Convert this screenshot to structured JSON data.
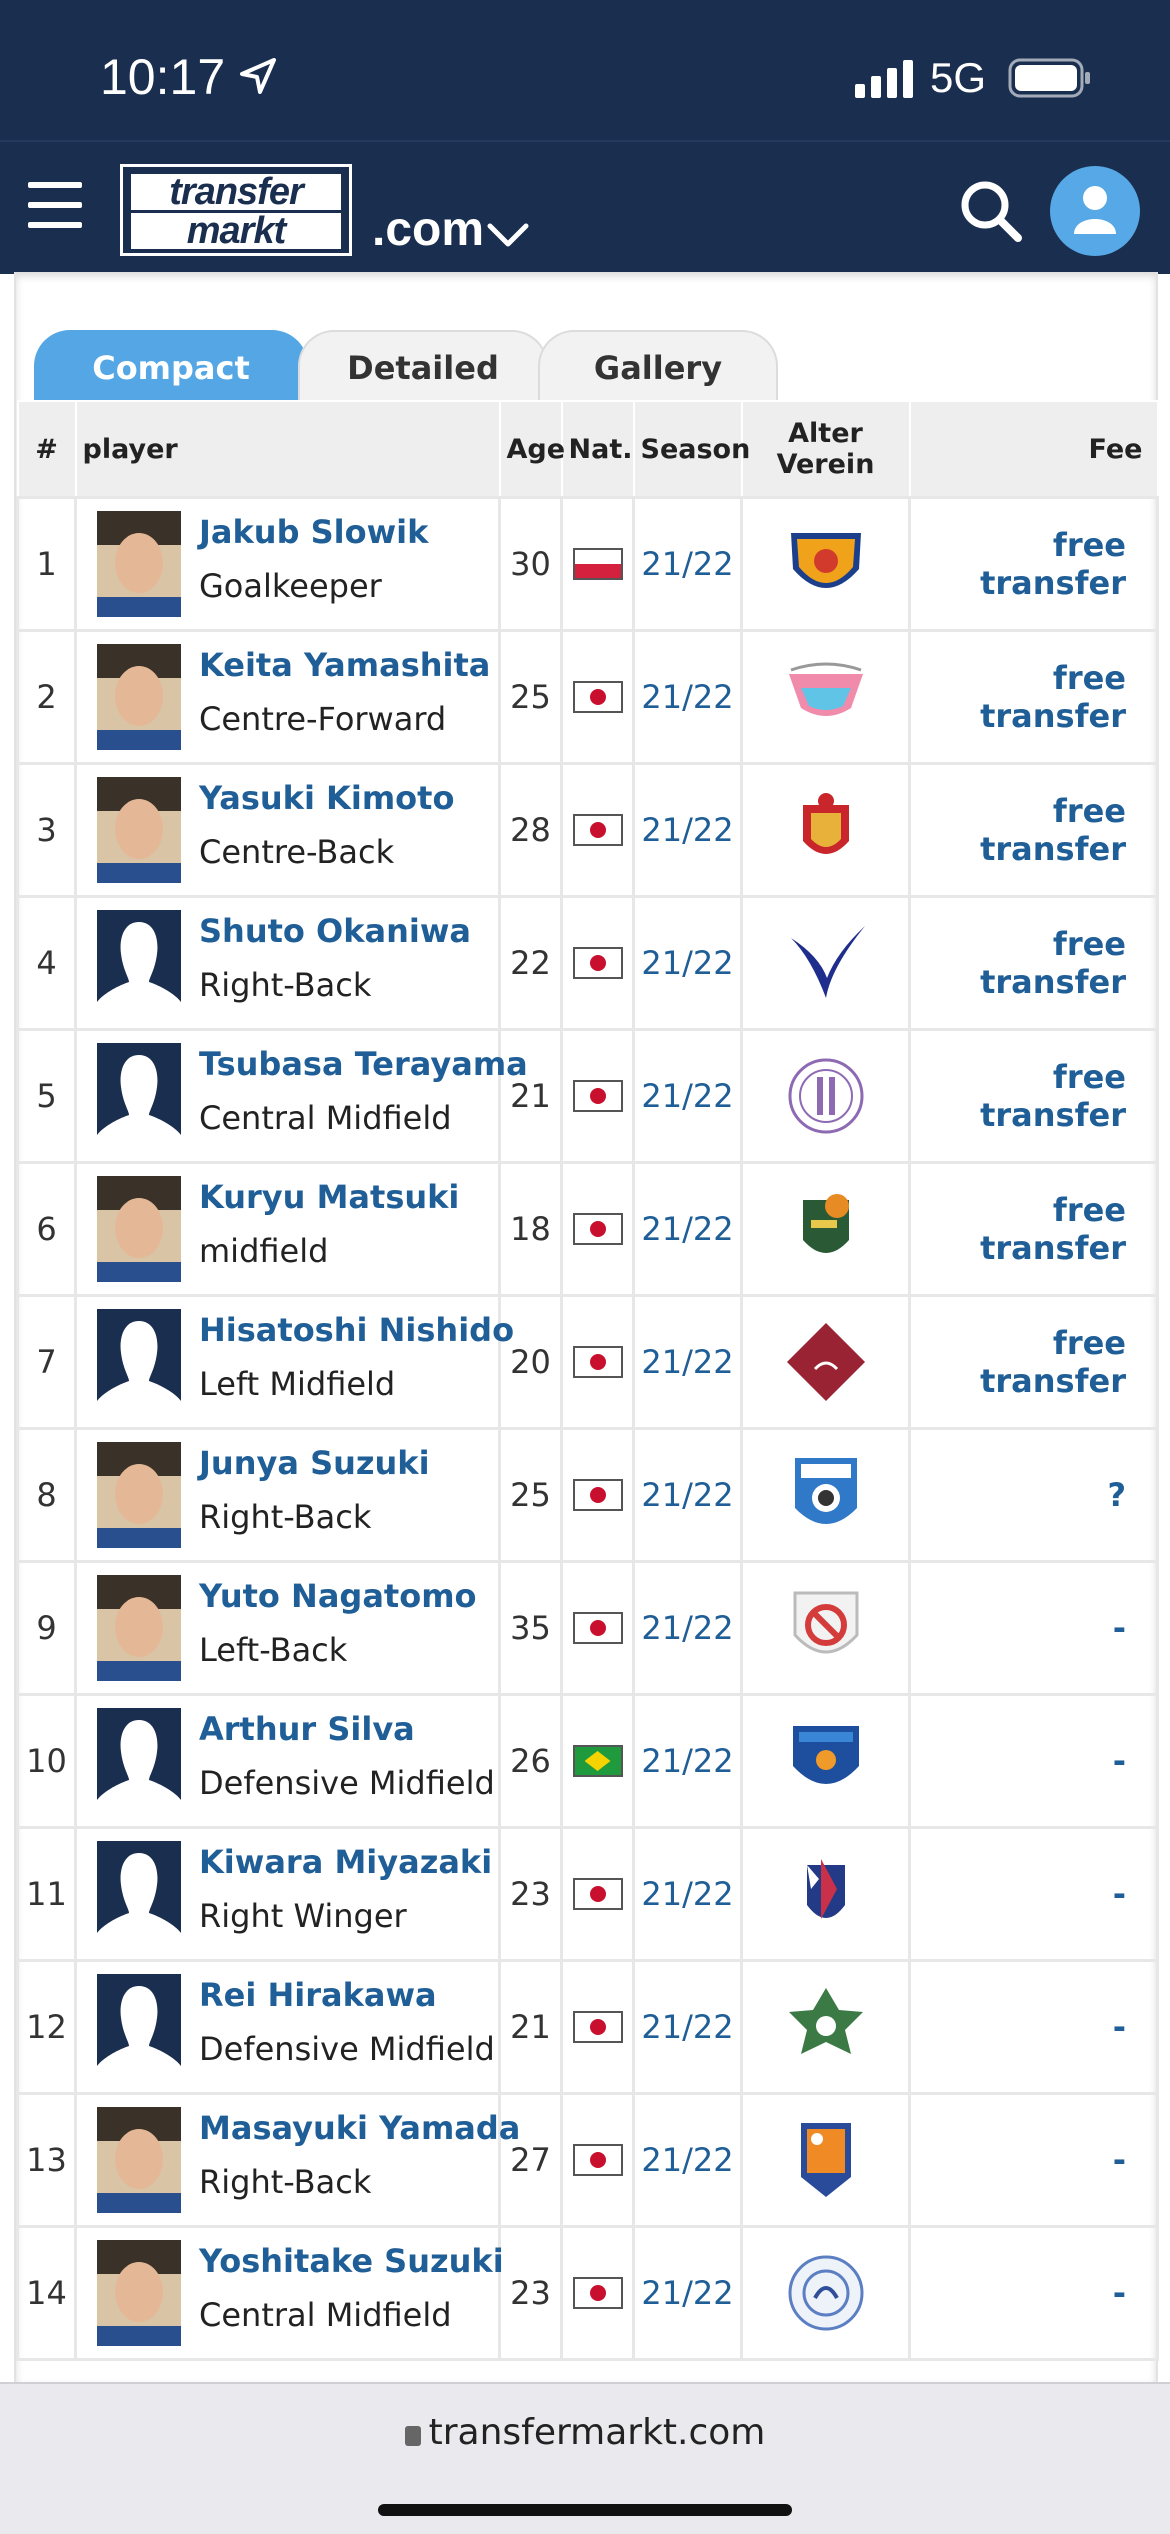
{
  "status_bar": {
    "time": "10:17",
    "network": "5G"
  },
  "header": {
    "logo_line1": "transfer",
    "logo_line2": "markt",
    "domain": ".com"
  },
  "tabs": [
    {
      "label": "Compact",
      "active": true
    },
    {
      "label": "Detailed",
      "active": false
    },
    {
      "label": "Gallery",
      "active": false
    }
  ],
  "columns": {
    "num": "#",
    "player": "player",
    "age": "Age",
    "nat": "Nat.",
    "season": "Season",
    "club": "Alter Verein",
    "fee": "Fee"
  },
  "rows": [
    {
      "num": "1",
      "name": "Jakub Slowik",
      "position": "Goalkeeper",
      "age": "30",
      "nat": "pl",
      "season": "21/22",
      "fee": "free transfer",
      "photo": "face"
    },
    {
      "num": "2",
      "name": "Keita Yamashita",
      "position": "Centre-Forward",
      "age": "25",
      "nat": "jp",
      "season": "21/22",
      "fee": "free transfer",
      "photo": "face"
    },
    {
      "num": "3",
      "name": "Yasuki Kimoto",
      "position": "Centre-Back",
      "age": "28",
      "nat": "jp",
      "season": "21/22",
      "fee": "free transfer",
      "photo": "face"
    },
    {
      "num": "4",
      "name": "Shuto Okaniwa",
      "position": "Right-Back",
      "age": "22",
      "nat": "jp",
      "season": "21/22",
      "fee": "free transfer",
      "photo": "blank"
    },
    {
      "num": "5",
      "name": "Tsubasa Terayama",
      "position": "Central Midfield",
      "age": "21",
      "nat": "jp",
      "season": "21/22",
      "fee": "free transfer",
      "photo": "blank"
    },
    {
      "num": "6",
      "name": "Kuryu Matsuki",
      "position": "midfield",
      "age": "18",
      "nat": "jp",
      "season": "21/22",
      "fee": "free transfer",
      "photo": "face"
    },
    {
      "num": "7",
      "name": "Hisatoshi Nishido",
      "position": "Left Midfield",
      "age": "20",
      "nat": "jp",
      "season": "21/22",
      "fee": "free transfer",
      "photo": "blank"
    },
    {
      "num": "8",
      "name": "Junya Suzuki",
      "position": "Right-Back",
      "age": "25",
      "nat": "jp",
      "season": "21/22",
      "fee": "?",
      "photo": "face"
    },
    {
      "num": "9",
      "name": "Yuto Nagatomo",
      "position": "Left-Back",
      "age": "35",
      "nat": "jp",
      "season": "21/22",
      "fee": "-",
      "photo": "face"
    },
    {
      "num": "10",
      "name": "Arthur Silva",
      "position": "Defensive Midfield",
      "age": "26",
      "nat": "br",
      "season": "21/22",
      "fee": "-",
      "photo": "blank"
    },
    {
      "num": "11",
      "name": "Kiwara Miyazaki",
      "position": "Right Winger",
      "age": "23",
      "nat": "jp",
      "season": "21/22",
      "fee": "-",
      "photo": "blank"
    },
    {
      "num": "12",
      "name": "Rei Hirakawa",
      "position": "Defensive Midfield",
      "age": "21",
      "nat": "jp",
      "season": "21/22",
      "fee": "-",
      "photo": "blank"
    },
    {
      "num": "13",
      "name": "Masayuki Yamada",
      "position": "Right-Back",
      "age": "27",
      "nat": "jp",
      "season": "21/22",
      "fee": "-",
      "photo": "face"
    },
    {
      "num": "14",
      "name": "Yoshitake Suzuki",
      "position": "Central Midfield",
      "age": "23",
      "nat": "jp",
      "season": "21/22",
      "fee": "-",
      "photo": "face"
    }
  ],
  "browser": {
    "url": "transfermarkt.com"
  },
  "colors": {
    "navy": "#1a2e4f",
    "accent_blue": "#54a6e4",
    "link_blue": "#1f5e96"
  }
}
